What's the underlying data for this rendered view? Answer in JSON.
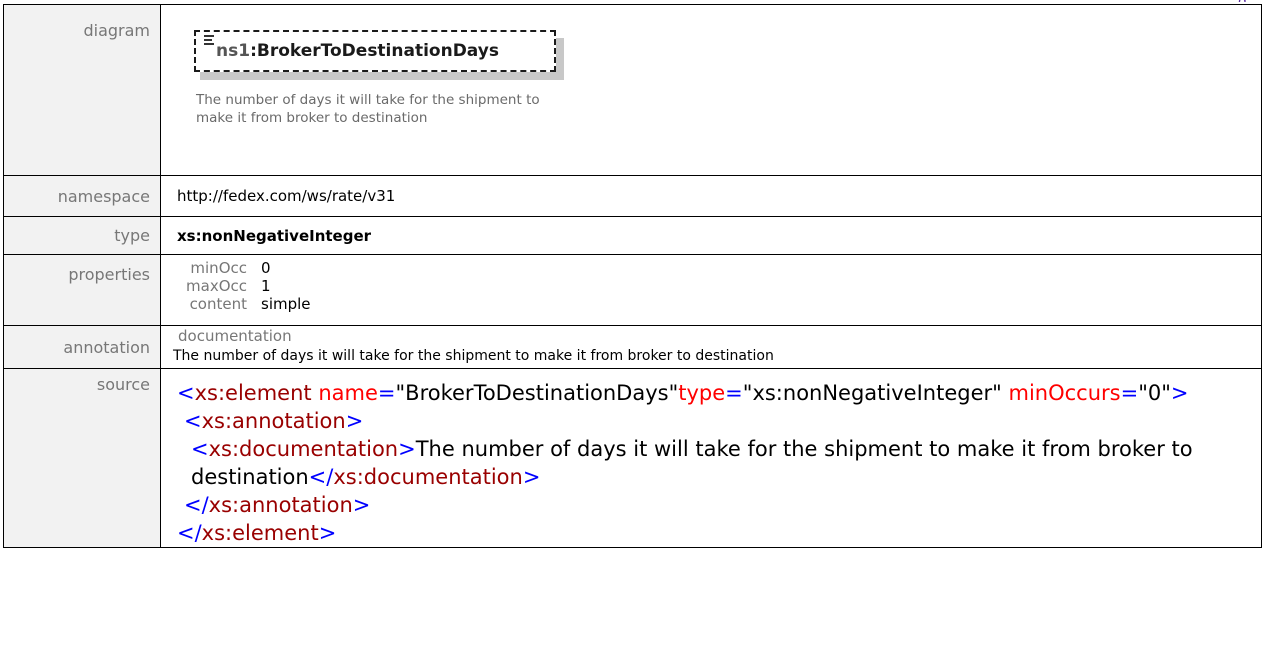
{
  "labels": {
    "diagram": "diagram",
    "namespace": "namespace",
    "type": "type",
    "properties": "properties",
    "annotation": "annotation",
    "source": "source"
  },
  "diagram": {
    "prefix": "ns1",
    "colon": ":",
    "name": "BrokerToDestinationDays",
    "description": "The number of days it will take for the shipment to make it from broker to destination"
  },
  "namespace_value": "http://fedex.com/ws/rate/v31",
  "type_value": "xs:nonNegativeInteger",
  "properties": [
    {
      "key": "minOcc",
      "value": "0"
    },
    {
      "key": "maxOcc",
      "value": "1"
    },
    {
      "key": "content",
      "value": "simple"
    }
  ],
  "annotation": {
    "label": "documentation",
    "text": "The number of days it will take for the shipment to make it from broker to destination"
  },
  "source": {
    "lt": "<",
    "gt": ">",
    "close_lt": "</",
    "element_tag": "xs:element",
    "name_attr": "name",
    "eq": "=",
    "name_value": "\"BrokerToDestinationDays\"",
    "type_attr": "type",
    "type_value": "\"xs:nonNegativeInteger\"",
    "minoccurs_attr": "minOccurs",
    "minoccurs_value": "\"0\"",
    "annotation_tag": "xs:annotation",
    "documentation_tag": "xs:documentation",
    "documentation_text": "The number of days it will take for the shipment to make it from broker to destination"
  },
  "colors": {
    "tag_bracket": "#0000ff",
    "tag_name": "#990000",
    "attribute": "#ff0000",
    "label_text": "#777777",
    "label_background": "#f2f2f2"
  }
}
